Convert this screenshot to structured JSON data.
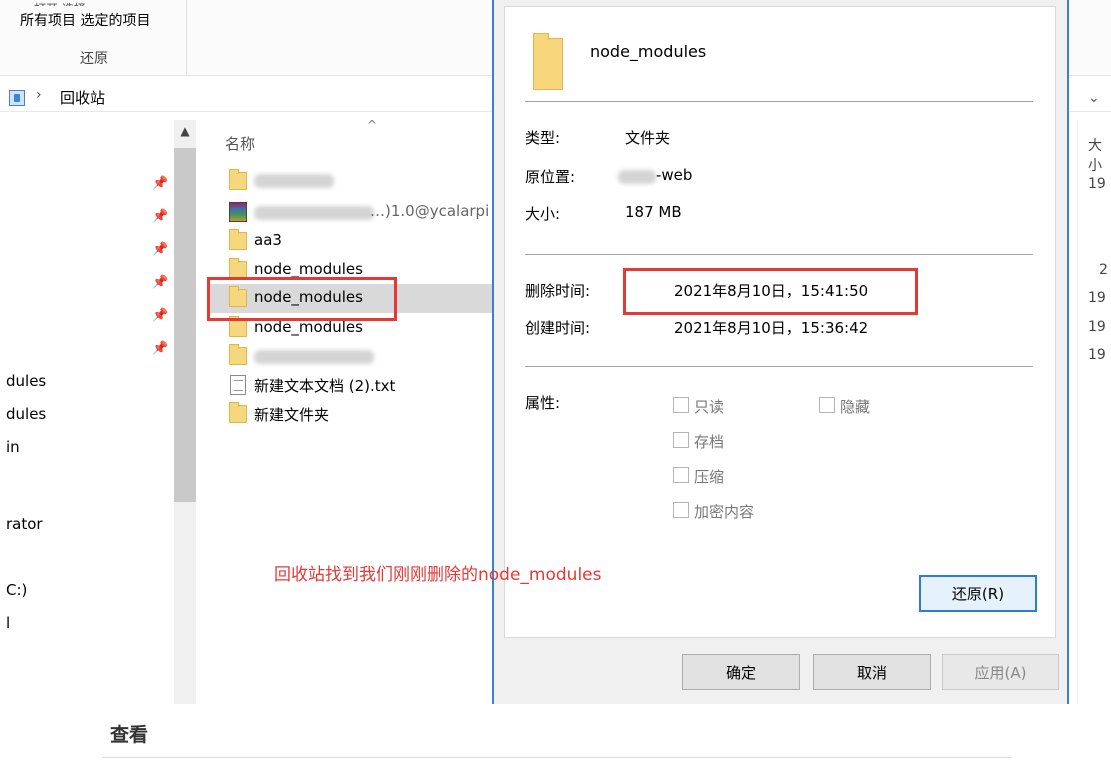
{
  "ribbon": {
    "clipped_labels": "打开  选择",
    "actions_text": "所有项目 选定的项目",
    "group_label": "还原"
  },
  "address": {
    "path": "回收站"
  },
  "nav": {
    "items": [
      "dules",
      "dules",
      "in",
      "rator",
      "C:)",
      "l"
    ]
  },
  "file_list": {
    "column_header": "名称",
    "rows": [
      {
        "name": "",
        "type": "folder",
        "blurred": true
      },
      {
        "name": "…)1.0@ycalarpi",
        "type": "archive",
        "blurred": true
      },
      {
        "name": "aa3",
        "type": "folder"
      },
      {
        "name": "node_modules",
        "type": "folder"
      },
      {
        "name": "node_modules",
        "type": "folder",
        "selected": true
      },
      {
        "name": "node_modules",
        "type": "folder"
      },
      {
        "name": "",
        "type": "folder",
        "blurred": true
      },
      {
        "name": "新建文本文档 (2).txt",
        "type": "text"
      },
      {
        "name": "新建文件夹",
        "type": "folder"
      }
    ]
  },
  "right_column": {
    "header": "大小",
    "values": [
      "19",
      "2",
      "19",
      "19",
      "19"
    ]
  },
  "dialog": {
    "title": "node_modules",
    "type_label": "类型:",
    "type_value": "文件夹",
    "origin_label": "原位置:",
    "origin_value": "-web",
    "size_label": "大小:",
    "size_value": "187 MB",
    "deleted_label": "删除时间:",
    "deleted_value": "2021年8月10日，15:41:50",
    "created_label": "创建时间:",
    "created_value": "2021年8月10日，15:36:42",
    "attr_label": "属性:",
    "attributes": {
      "readonly": "只读",
      "hidden": "隐藏",
      "archive": "存档",
      "compress": "压缩",
      "encrypt": "加密内容"
    },
    "restore_button": "还原(R)",
    "ok_button": "确定",
    "cancel_button": "取消",
    "apply_button": "应用(A)"
  },
  "annotation": {
    "caption": "回收站找到我们刚刚删除的node_modules",
    "highlight_color": "#e53935"
  },
  "bottom": {
    "title": "查看"
  }
}
